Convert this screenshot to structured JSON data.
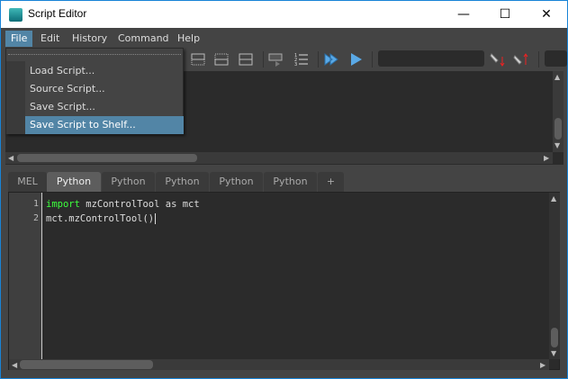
{
  "window": {
    "title": "Script Editor",
    "minimize": "—",
    "maximize": "☐",
    "close": "✕"
  },
  "menubar": [
    "File",
    "Edit",
    "History",
    "Command",
    "Help"
  ],
  "file_menu": [
    "Load Script...",
    "Source Script...",
    "Save Script...",
    "Save Script to Shelf..."
  ],
  "file_menu_highlighted": "Save Script to Shelf...",
  "tabs": [
    "MEL",
    "Python",
    "Python",
    "Python",
    "Python",
    "Python",
    "+"
  ],
  "active_tab": 1,
  "editor": {
    "line_numbers": [
      "1",
      "2"
    ],
    "line1_keyword": "import",
    "line1_rest": " mzControlTool as mct",
    "line2": "mct.mzControlTool()"
  },
  "colors": {
    "accent": "#5285a6",
    "keyword": "#3dff3d",
    "border": "#1883d7"
  }
}
